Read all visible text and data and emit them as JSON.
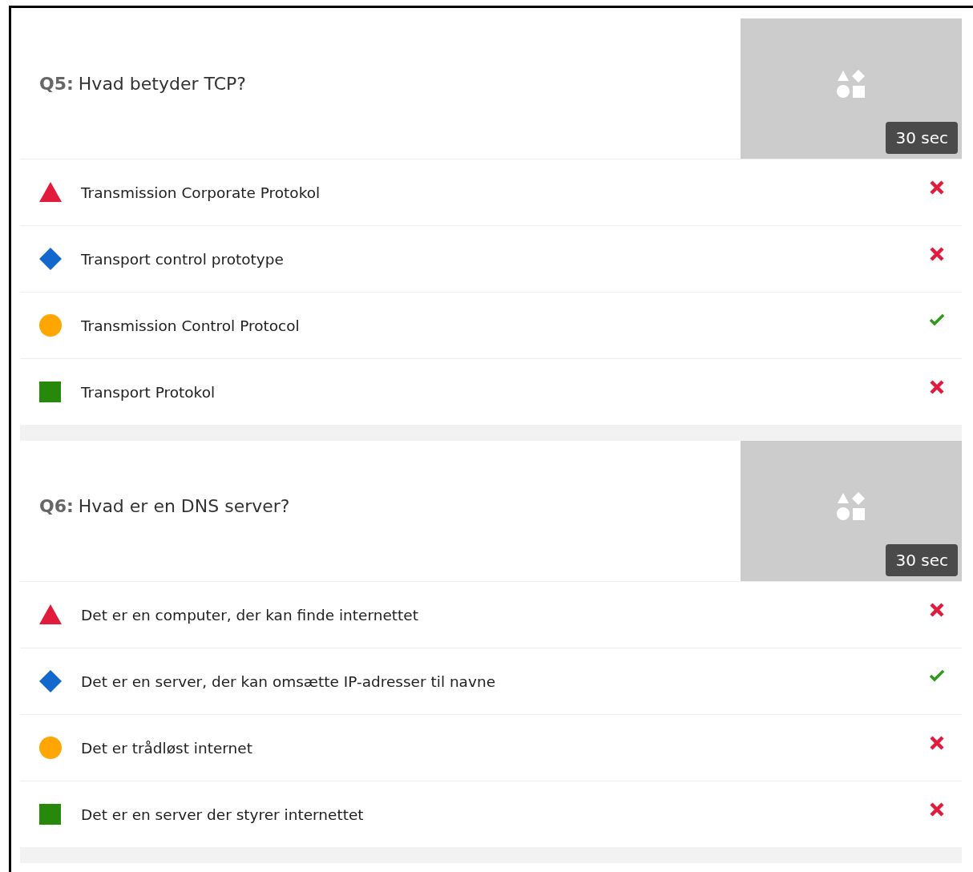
{
  "questions": [
    {
      "number": "Q5:",
      "text": "Hvad betyder TCP?",
      "time": "30 sec",
      "answers": [
        {
          "kind": "triangle",
          "text": "Transmission Corporate Protokol",
          "correct": false
        },
        {
          "kind": "diamond",
          "text": "Transport control prototype",
          "correct": false
        },
        {
          "kind": "circle",
          "text": "Transmission Control Protocol",
          "correct": true
        },
        {
          "kind": "square",
          "text": "Transport Protokol",
          "correct": false
        }
      ]
    },
    {
      "number": "Q6:",
      "text": "Hvad er en DNS server?",
      "time": "30 sec",
      "answers": [
        {
          "kind": "triangle",
          "text": "Det er en computer, der kan finde internettet",
          "correct": false
        },
        {
          "kind": "diamond",
          "text": "Det er en server, der kan omsætte IP-adresser til navne",
          "correct": true
        },
        {
          "kind": "circle",
          "text": "Det er trådløst internet",
          "correct": false
        },
        {
          "kind": "square",
          "text": "Det er en server der styrer internettet",
          "correct": false
        }
      ]
    }
  ]
}
